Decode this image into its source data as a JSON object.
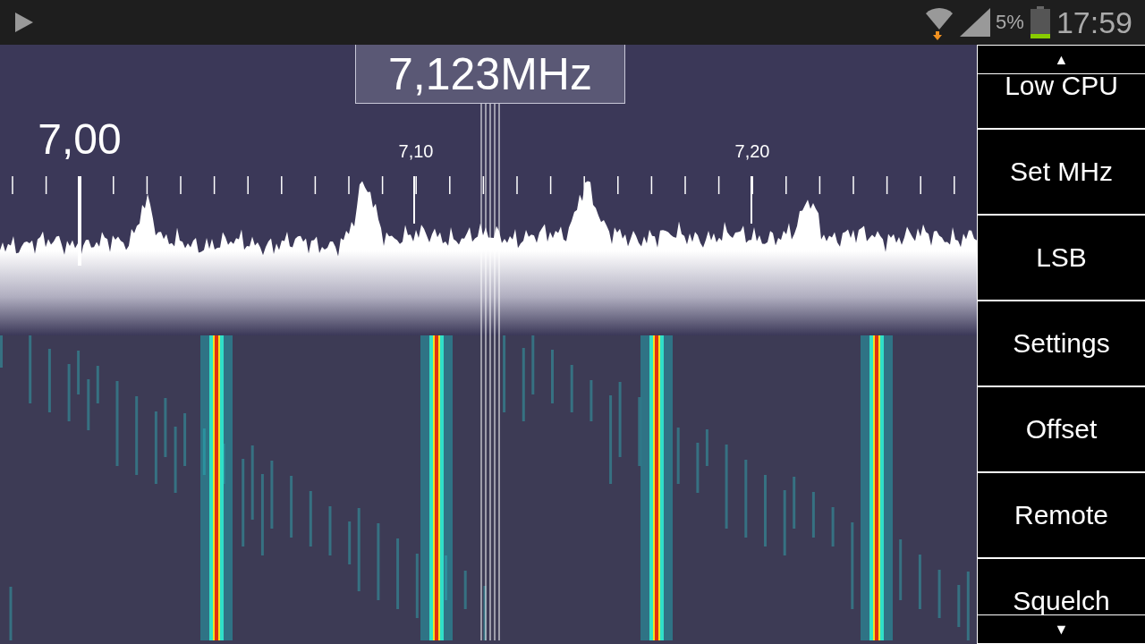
{
  "status_bar": {
    "battery": "5%",
    "time": "17:59"
  },
  "tuner": {
    "frequency": "7,123MHz",
    "scale_labels": [
      {
        "label": "7,00",
        "kind": "major"
      },
      {
        "label": "7,10",
        "kind": "minor"
      },
      {
        "label": "7,20",
        "kind": "minor"
      }
    ]
  },
  "menu": {
    "scroll_up": "▲",
    "items": [
      "Low CPU",
      "Set MHz",
      "LSB",
      "Settings",
      "Offset",
      "Remote",
      "Squelch"
    ],
    "scroll_down": "▼"
  }
}
